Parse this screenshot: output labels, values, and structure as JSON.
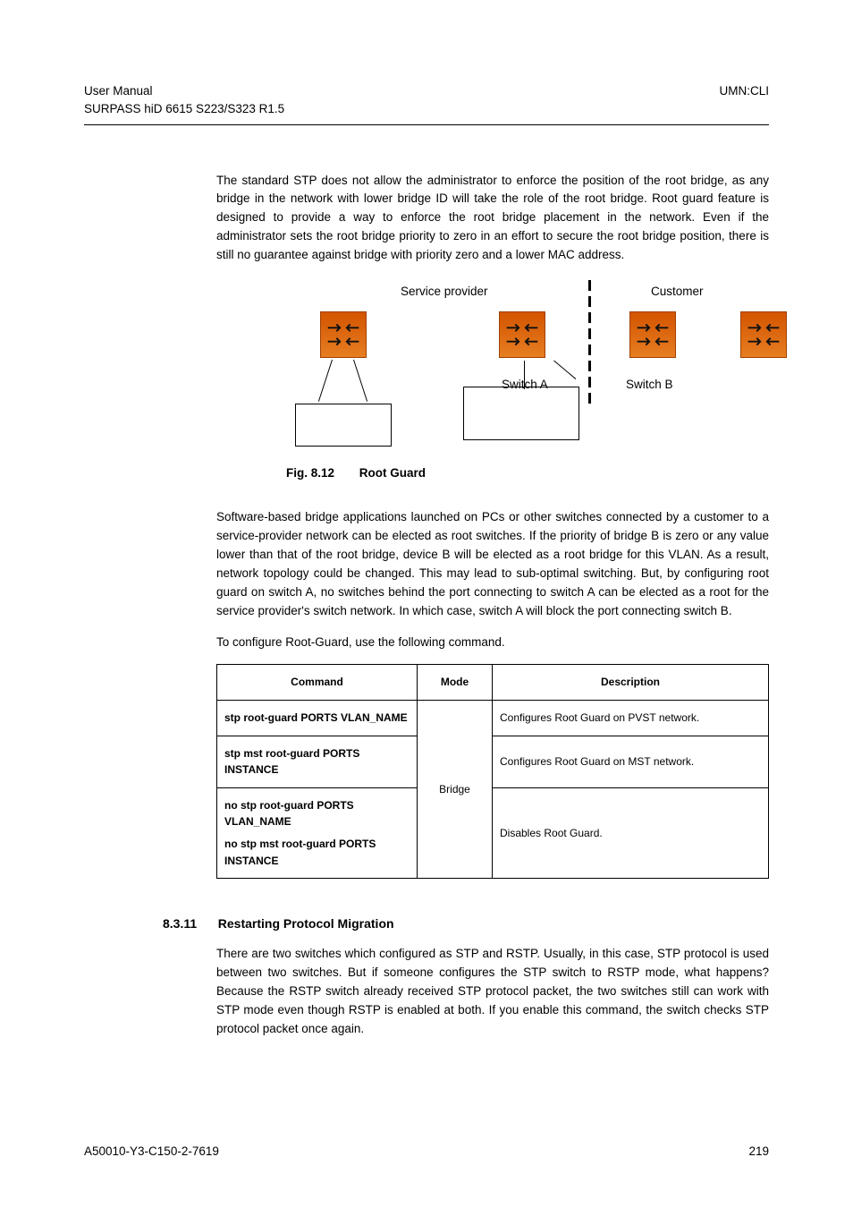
{
  "header": {
    "left_line1": "User Manual",
    "left_line2": "SURPASS hiD 6615 S223/S323 R1.5",
    "right_line1": "UMN:CLI"
  },
  "intro_para": "The standard STP does not allow the administrator to enforce the position of the root bridge, as any bridge in the network with lower bridge ID will take the role of the root bridge. Root guard feature is designed to provide a way to enforce the root bridge placement in the network. Even if the administrator sets the root bridge priority to zero in an effort to secure the root bridge position, there is still no guarantee against bridge with priority zero and a lower MAC address.",
  "diagram": {
    "sp": "Service provider",
    "cust": "Customer",
    "swa": "Switch A",
    "swb": "Switch B"
  },
  "fig": {
    "num": "Fig. 8.12",
    "caption": "Root Guard"
  },
  "para2": "Software-based bridge applications launched on PCs or other switches connected by a customer to a service-provider network can be elected as root switches. If the priority of bridge B is zero or any value lower than that of the root bridge, device B will be elected as a root bridge for this VLAN. As a result, network topology could be changed. This may lead to sub-optimal switching. But, by configuring root guard on switch A, no switches behind the port connecting to switch A can be elected as a root for the service provider's switch network. In which case, switch A will block the port connecting switch B.",
  "para3": "To configure Root-Guard, use the following command.",
  "table": {
    "h1": "Command",
    "h2": "Mode",
    "h3": "Description",
    "mode": "Bridge",
    "r1c1": "stp root-guard PORTS VLAN_NAME",
    "r1c3": "Configures Root Guard on PVST network.",
    "r2c1": "stp mst root-guard PORTS INSTANCE",
    "r2c3": "Configures Root Guard on MST network.",
    "r3c1a": "no stp root-guard PORTS VLAN_NAME",
    "r3c1b": "no stp mst root-guard PORTS INSTANCE",
    "r3c3": "Disables Root Guard."
  },
  "section": {
    "num": "8.3.11",
    "title": "Restarting Protocol Migration"
  },
  "para4": "There are two switches which configured as STP and RSTP. Usually, in this case, STP protocol is used between two switches. But if someone configures the STP switch to RSTP mode, what happens? Because the RSTP switch already received STP protocol packet, the two switches still can work with STP mode even though RSTP is enabled at both. If you enable this command, the switch checks STP protocol packet once again.",
  "footer": {
    "left": "A50010-Y3-C150-2-7619",
    "right": "219"
  }
}
